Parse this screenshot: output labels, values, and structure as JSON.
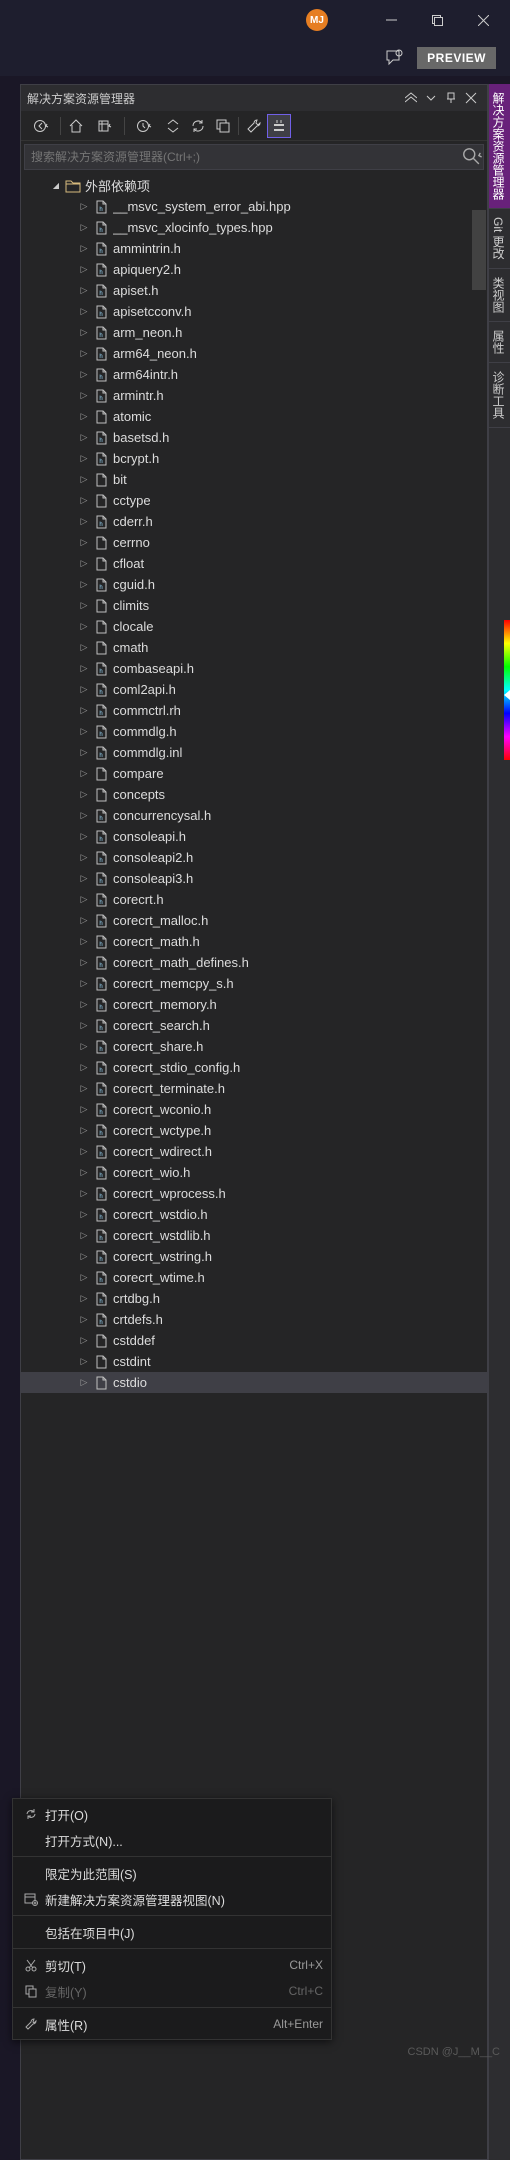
{
  "avatar": "MJ",
  "preview": "PREVIEW",
  "panel": {
    "title": "解决方案资源管理器"
  },
  "search": {
    "placeholder": "搜索解决方案资源管理器(Ctrl+;)"
  },
  "root": {
    "label": "外部依赖项"
  },
  "files": [
    "__msvc_system_error_abi.hpp",
    "__msvc_xlocinfo_types.hpp",
    "ammintrin.h",
    "apiquery2.h",
    "apiset.h",
    "apisetcconv.h",
    "arm_neon.h",
    "arm64_neon.h",
    "arm64intr.h",
    "armintr.h",
    "atomic",
    "basetsd.h",
    "bcrypt.h",
    "bit",
    "cctype",
    "cderr.h",
    "cerrno",
    "cfloat",
    "cguid.h",
    "climits",
    "clocale",
    "cmath",
    "combaseapi.h",
    "coml2api.h",
    "commctrl.rh",
    "commdlg.h",
    "commdlg.inl",
    "compare",
    "concepts",
    "concurrencysal.h",
    "consoleapi.h",
    "consoleapi2.h",
    "consoleapi3.h",
    "corecrt.h",
    "corecrt_malloc.h",
    "corecrt_math.h",
    "corecrt_math_defines.h",
    "corecrt_memcpy_s.h",
    "corecrt_memory.h",
    "corecrt_search.h",
    "corecrt_share.h",
    "corecrt_stdio_config.h",
    "corecrt_terminate.h",
    "corecrt_wconio.h",
    "corecrt_wctype.h",
    "corecrt_wdirect.h",
    "corecrt_wio.h",
    "corecrt_wprocess.h",
    "corecrt_wstdio.h",
    "corecrt_wstdlib.h",
    "corecrt_wstring.h",
    "corecrt_wtime.h",
    "crtdbg.h",
    "crtdefs.h",
    "cstddef",
    "cstdint",
    "cstdio"
  ],
  "sidetabs": [
    "解决方案资源管理器",
    "Git 更改",
    "类视图",
    "属性",
    "诊断工具"
  ],
  "ctx": [
    {
      "icon": "refresh",
      "label": "打开(O)",
      "shortcut": ""
    },
    {
      "icon": "",
      "label": "打开方式(N)...",
      "shortcut": ""
    },
    {
      "sep": true
    },
    {
      "icon": "",
      "label": "限定为此范围(S)",
      "shortcut": ""
    },
    {
      "icon": "newview",
      "label": "新建解决方案资源管理器视图(N)",
      "shortcut": ""
    },
    {
      "sep": true
    },
    {
      "icon": "",
      "label": "包括在项目中(J)",
      "shortcut": ""
    },
    {
      "sep": true
    },
    {
      "icon": "cut",
      "label": "剪切(T)",
      "shortcut": "Ctrl+X"
    },
    {
      "icon": "copy",
      "label": "复制(Y)",
      "shortcut": "Ctrl+C",
      "disabled": true
    },
    {
      "sep": true
    },
    {
      "icon": "wrench",
      "label": "属性(R)",
      "shortcut": "Alt+Enter"
    }
  ],
  "watermark": "CSDN @J__M__C"
}
